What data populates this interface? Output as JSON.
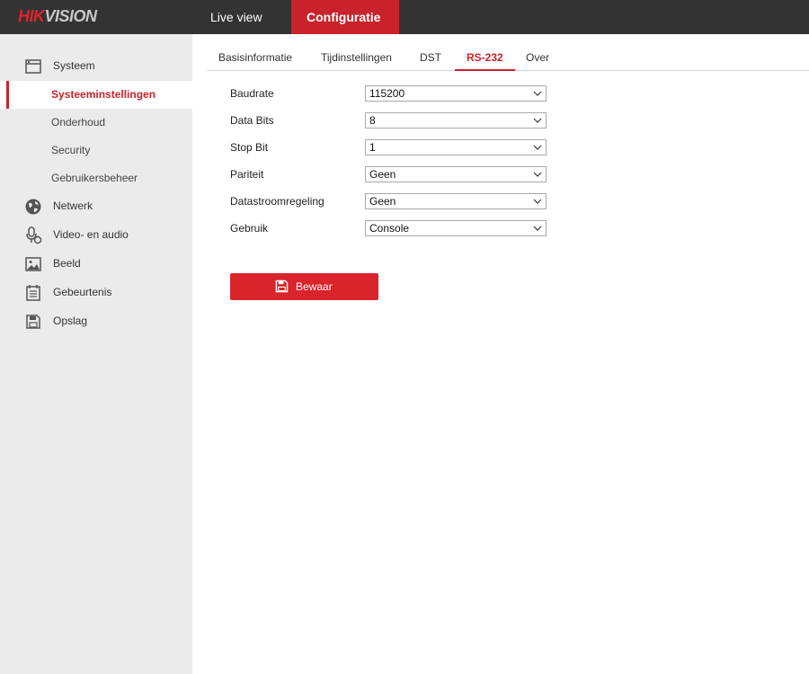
{
  "brand": {
    "part1": "HIK",
    "part2": "VISION"
  },
  "topnav": {
    "live_view": "Live view",
    "configuration": "Configuratie"
  },
  "sidebar": {
    "items": [
      {
        "label": "Systeem",
        "icon": "system-window-icon"
      },
      {
        "label": "Netwerk",
        "icon": "globe-icon"
      },
      {
        "label": "Video- en audio",
        "icon": "microphone-icon"
      },
      {
        "label": "Beeld",
        "icon": "image-icon"
      },
      {
        "label": "Gebeurtenis",
        "icon": "calendar-icon"
      },
      {
        "label": "Opslag",
        "icon": "floppy-disk-icon"
      }
    ],
    "subitems": [
      {
        "label": "Systeeminstellingen",
        "active": true
      },
      {
        "label": "Onderhoud"
      },
      {
        "label": "Security"
      },
      {
        "label": "Gebruikersbeheer"
      }
    ]
  },
  "tabs": [
    {
      "label": "Basisinformatie"
    },
    {
      "label": "Tijdinstellingen"
    },
    {
      "label": "DST"
    },
    {
      "label": "RS-232",
      "active": true
    },
    {
      "label": "Over"
    }
  ],
  "form": {
    "rows": [
      {
        "label": "Baudrate",
        "value": "115200"
      },
      {
        "label": "Data Bits",
        "value": "8"
      },
      {
        "label": "Stop Bit",
        "value": "1"
      },
      {
        "label": "Pariteit",
        "value": "Geen"
      },
      {
        "label": "Datastroomregeling",
        "value": "Geen"
      },
      {
        "label": "Gebruik",
        "value": "Console"
      }
    ]
  },
  "save_button": {
    "label": "Bewaar"
  },
  "colors": {
    "accent": "#c8232b",
    "topbar": "#333333",
    "sidebar_bg": "#ebebeb",
    "save_button": "#d9242c"
  }
}
